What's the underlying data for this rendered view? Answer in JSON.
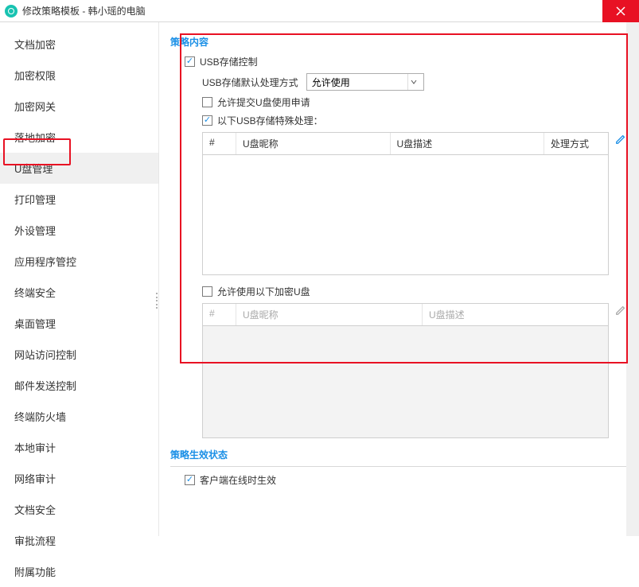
{
  "titlebar": {
    "title": "修改策略模板 - 韩小瑶的电脑"
  },
  "sidebar": {
    "items": [
      {
        "label": "文档加密"
      },
      {
        "label": "加密权限"
      },
      {
        "label": "加密网关"
      },
      {
        "label": "落地加密"
      },
      {
        "label": "U盘管理",
        "active": true
      },
      {
        "label": "打印管理"
      },
      {
        "label": "外设管理"
      },
      {
        "label": "应用程序管控"
      },
      {
        "label": "终端安全"
      },
      {
        "label": "桌面管理"
      },
      {
        "label": "网站访问控制"
      },
      {
        "label": "邮件发送控制"
      },
      {
        "label": "终端防火墙"
      },
      {
        "label": "本地审计"
      },
      {
        "label": "网络审计"
      },
      {
        "label": "文档安全"
      },
      {
        "label": "审批流程"
      },
      {
        "label": "附属功能"
      }
    ]
  },
  "content": {
    "section_title": "策略内容",
    "usb_control": {
      "checked": true,
      "label": "USB存储控制"
    },
    "default_handling": {
      "label": "USB存储默认处理方式",
      "value": "允许使用"
    },
    "allow_request": {
      "checked": false,
      "label": "允许提交U盘使用申请"
    },
    "special_handling": {
      "checked": true,
      "label": "以下USB存储特殊处理："
    },
    "table1": {
      "columns": {
        "num": "#",
        "nick": "U盘昵称",
        "desc": "U盘描述",
        "mode": "处理方式"
      }
    },
    "allow_encrypted": {
      "checked": false,
      "label": "允许使用以下加密U盘"
    },
    "table2": {
      "columns": {
        "num": "#",
        "nick": "U盘昵称",
        "desc": "U盘描述"
      }
    }
  },
  "status": {
    "section_title": "策略生效状态",
    "client_online": {
      "checked": true,
      "label": "客户端在线时生效"
    }
  }
}
